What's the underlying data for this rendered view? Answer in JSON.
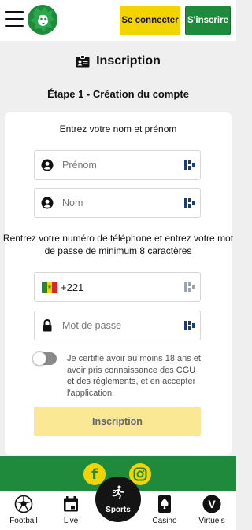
{
  "header": {
    "login_label": "Se connecter",
    "signup_label": "S'inscrire",
    "accent_yellow": "#f3d400",
    "accent_green": "#1f8a3c"
  },
  "page": {
    "title": "Inscription",
    "step_title": "Étape 1 - Création du compte"
  },
  "form": {
    "name_section_label": "Entrez votre nom et prénom",
    "first_name_placeholder": "Prénom",
    "last_name_placeholder": "Nom",
    "phone_section_label": "Rentrez votre numéro de téléphone et entrez votre mot de passe de minimum 8 caractères",
    "phone_prefix": "+221",
    "password_placeholder": "Mot de passe",
    "consent_prefix": "Je certifie avoir au moins 18 ans et avoir pris connaissance des ",
    "consent_link": "CGU et des réglements",
    "consent_suffix": ", et en accepter l'application.",
    "submit_label": "Inscription"
  },
  "footer": {
    "social": [
      "facebook-icon",
      "instagram-icon"
    ]
  },
  "bottom_nav": {
    "items": [
      {
        "label": "Football",
        "icon": "soccer-ball-icon"
      },
      {
        "label": "Live",
        "icon": "calendar-icon"
      },
      {
        "label": "Sports",
        "icon": "sports-runner-icon"
      },
      {
        "label": "Casino",
        "icon": "spade-card-icon"
      },
      {
        "label": "Virtuels",
        "icon": "v-circle-icon"
      }
    ]
  }
}
